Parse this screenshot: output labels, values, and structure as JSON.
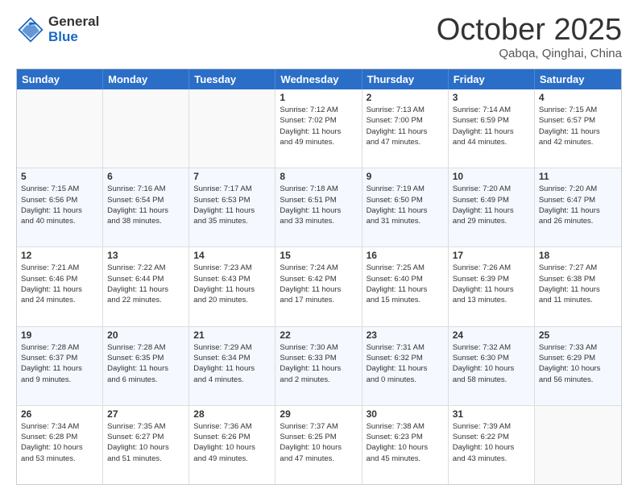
{
  "logo": {
    "general": "General",
    "blue": "Blue"
  },
  "header": {
    "month": "October 2025",
    "location": "Qabqa, Qinghai, China"
  },
  "dayHeaders": [
    "Sunday",
    "Monday",
    "Tuesday",
    "Wednesday",
    "Thursday",
    "Friday",
    "Saturday"
  ],
  "weeks": [
    [
      {
        "day": "",
        "info": ""
      },
      {
        "day": "",
        "info": ""
      },
      {
        "day": "",
        "info": ""
      },
      {
        "day": "1",
        "info": "Sunrise: 7:12 AM\nSunset: 7:02 PM\nDaylight: 11 hours\nand 49 minutes."
      },
      {
        "day": "2",
        "info": "Sunrise: 7:13 AM\nSunset: 7:00 PM\nDaylight: 11 hours\nand 47 minutes."
      },
      {
        "day": "3",
        "info": "Sunrise: 7:14 AM\nSunset: 6:59 PM\nDaylight: 11 hours\nand 44 minutes."
      },
      {
        "day": "4",
        "info": "Sunrise: 7:15 AM\nSunset: 6:57 PM\nDaylight: 11 hours\nand 42 minutes."
      }
    ],
    [
      {
        "day": "5",
        "info": "Sunrise: 7:15 AM\nSunset: 6:56 PM\nDaylight: 11 hours\nand 40 minutes."
      },
      {
        "day": "6",
        "info": "Sunrise: 7:16 AM\nSunset: 6:54 PM\nDaylight: 11 hours\nand 38 minutes."
      },
      {
        "day": "7",
        "info": "Sunrise: 7:17 AM\nSunset: 6:53 PM\nDaylight: 11 hours\nand 35 minutes."
      },
      {
        "day": "8",
        "info": "Sunrise: 7:18 AM\nSunset: 6:51 PM\nDaylight: 11 hours\nand 33 minutes."
      },
      {
        "day": "9",
        "info": "Sunrise: 7:19 AM\nSunset: 6:50 PM\nDaylight: 11 hours\nand 31 minutes."
      },
      {
        "day": "10",
        "info": "Sunrise: 7:20 AM\nSunset: 6:49 PM\nDaylight: 11 hours\nand 29 minutes."
      },
      {
        "day": "11",
        "info": "Sunrise: 7:20 AM\nSunset: 6:47 PM\nDaylight: 11 hours\nand 26 minutes."
      }
    ],
    [
      {
        "day": "12",
        "info": "Sunrise: 7:21 AM\nSunset: 6:46 PM\nDaylight: 11 hours\nand 24 minutes."
      },
      {
        "day": "13",
        "info": "Sunrise: 7:22 AM\nSunset: 6:44 PM\nDaylight: 11 hours\nand 22 minutes."
      },
      {
        "day": "14",
        "info": "Sunrise: 7:23 AM\nSunset: 6:43 PM\nDaylight: 11 hours\nand 20 minutes."
      },
      {
        "day": "15",
        "info": "Sunrise: 7:24 AM\nSunset: 6:42 PM\nDaylight: 11 hours\nand 17 minutes."
      },
      {
        "day": "16",
        "info": "Sunrise: 7:25 AM\nSunset: 6:40 PM\nDaylight: 11 hours\nand 15 minutes."
      },
      {
        "day": "17",
        "info": "Sunrise: 7:26 AM\nSunset: 6:39 PM\nDaylight: 11 hours\nand 13 minutes."
      },
      {
        "day": "18",
        "info": "Sunrise: 7:27 AM\nSunset: 6:38 PM\nDaylight: 11 hours\nand 11 minutes."
      }
    ],
    [
      {
        "day": "19",
        "info": "Sunrise: 7:28 AM\nSunset: 6:37 PM\nDaylight: 11 hours\nand 9 minutes."
      },
      {
        "day": "20",
        "info": "Sunrise: 7:28 AM\nSunset: 6:35 PM\nDaylight: 11 hours\nand 6 minutes."
      },
      {
        "day": "21",
        "info": "Sunrise: 7:29 AM\nSunset: 6:34 PM\nDaylight: 11 hours\nand 4 minutes."
      },
      {
        "day": "22",
        "info": "Sunrise: 7:30 AM\nSunset: 6:33 PM\nDaylight: 11 hours\nand 2 minutes."
      },
      {
        "day": "23",
        "info": "Sunrise: 7:31 AM\nSunset: 6:32 PM\nDaylight: 11 hours\nand 0 minutes."
      },
      {
        "day": "24",
        "info": "Sunrise: 7:32 AM\nSunset: 6:30 PM\nDaylight: 10 hours\nand 58 minutes."
      },
      {
        "day": "25",
        "info": "Sunrise: 7:33 AM\nSunset: 6:29 PM\nDaylight: 10 hours\nand 56 minutes."
      }
    ],
    [
      {
        "day": "26",
        "info": "Sunrise: 7:34 AM\nSunset: 6:28 PM\nDaylight: 10 hours\nand 53 minutes."
      },
      {
        "day": "27",
        "info": "Sunrise: 7:35 AM\nSunset: 6:27 PM\nDaylight: 10 hours\nand 51 minutes."
      },
      {
        "day": "28",
        "info": "Sunrise: 7:36 AM\nSunset: 6:26 PM\nDaylight: 10 hours\nand 49 minutes."
      },
      {
        "day": "29",
        "info": "Sunrise: 7:37 AM\nSunset: 6:25 PM\nDaylight: 10 hours\nand 47 minutes."
      },
      {
        "day": "30",
        "info": "Sunrise: 7:38 AM\nSunset: 6:23 PM\nDaylight: 10 hours\nand 45 minutes."
      },
      {
        "day": "31",
        "info": "Sunrise: 7:39 AM\nSunset: 6:22 PM\nDaylight: 10 hours\nand 43 minutes."
      },
      {
        "day": "",
        "info": ""
      }
    ]
  ]
}
